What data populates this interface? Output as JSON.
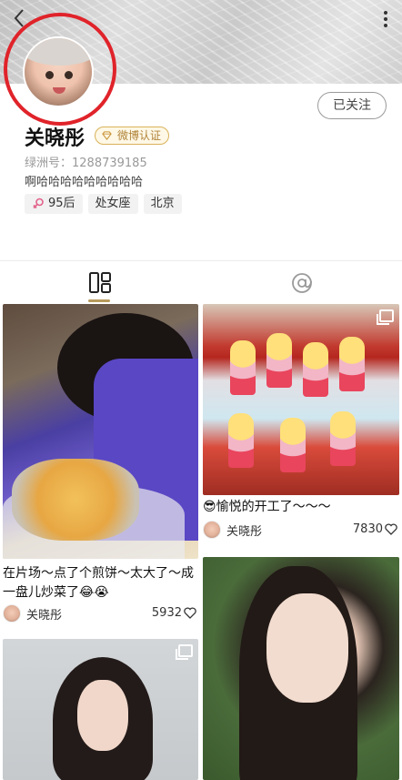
{
  "profile": {
    "name": "关晓彤",
    "verify_badge": "微博认证",
    "oasis_id_label": "绿洲号：",
    "oasis_id": "1288739185",
    "bio": "啊哈哈哈哈哈哈哈哈哈",
    "follow_button": "已关注",
    "tags": [
      "95后",
      "处女座",
      "北京"
    ]
  },
  "tabs": [
    {
      "icon": "grid-icon",
      "active": true
    },
    {
      "icon": "at-icon",
      "active": false
    }
  ],
  "feed": [
    {
      "caption": "在片场～点了个煎饼～太大了～成一盘儿炒菜了😂😭",
      "author": "关晓彤",
      "likes": "5932"
    },
    {
      "caption": "😎愉悦的开工了～～～",
      "author": "关晓彤",
      "likes": "7830"
    }
  ],
  "colors": {
    "highlight_ring": "#e0232a",
    "verify_gold": "#d8b25a",
    "tab_underline": "#b79a5c"
  }
}
